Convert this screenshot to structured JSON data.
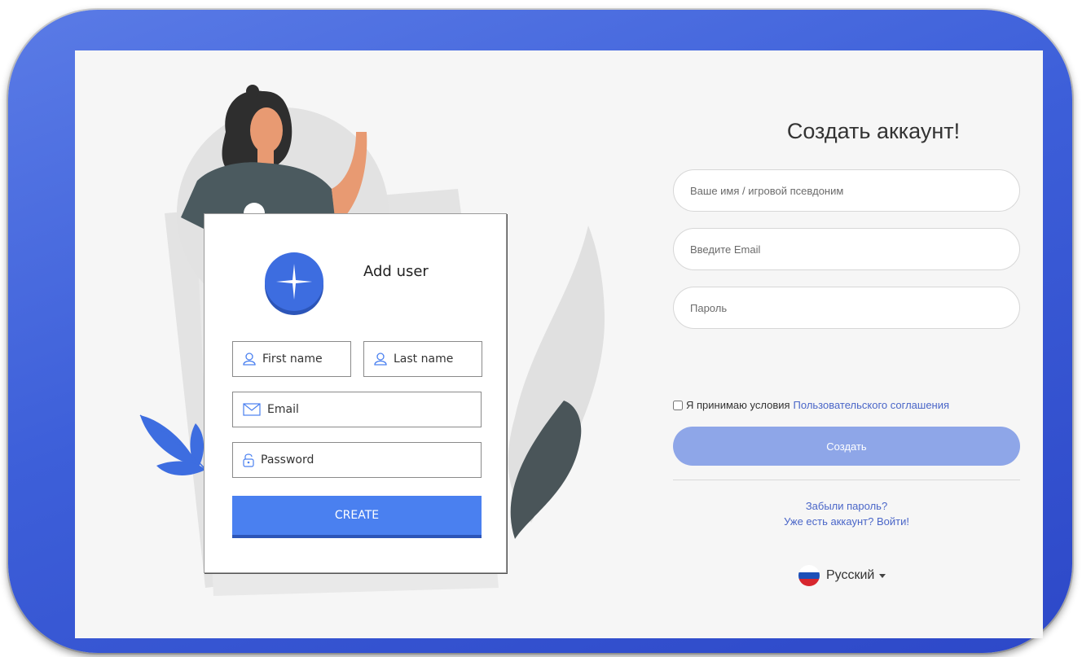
{
  "illustration": {
    "card_title": "Add user",
    "first_name": "First name",
    "last_name": "Last name",
    "email": "Email",
    "password": "Password",
    "create": "CREATE"
  },
  "form": {
    "title": "Создать аккаунт!",
    "name_placeholder": "Ваше имя / игровой псевдоним",
    "email_placeholder": "Введите Email",
    "password_placeholder": "Пароль",
    "agree_text": "Я принимаю условия",
    "agree_link": "Пользовательского соглашения",
    "submit": "Создать",
    "forgot_password": "Забыли пароль?",
    "have_account": "Уже есть аккаунт? Войти!"
  },
  "language": {
    "selected": "Русский",
    "flag_icon": "russia-flag-icon"
  },
  "colors": {
    "frame": "#3d5fd9",
    "accent": "#4a80f0",
    "submit_button": "#8ea6e8",
    "link": "#4a66c8"
  }
}
